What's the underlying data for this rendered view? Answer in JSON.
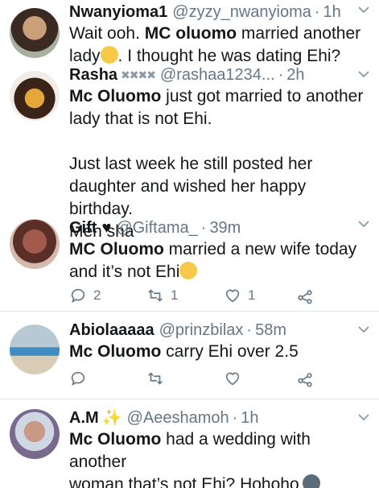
{
  "tweets": [
    {
      "name": "Nwanyioma1",
      "handle": "@zyzy_nwanyioma",
      "time": "1h",
      "line1_prefix": "Wait ooh. ",
      "line1_bold": "MC oluomo",
      "line1_suffix": " married another",
      "line2_prefix": "lady",
      "line2_suffix": ". I thought he was dating Ehi?",
      "emoji": "hand-over-mouth-emoji"
    },
    {
      "name": "Rasha",
      "name_decor": "✖✖✖✖",
      "handle": "@rashaa1234...",
      "time": "2h",
      "line1_bold": "Mc Oluomo",
      "line1_suffix": " just got married to another",
      "line2": "lady that is not Ehi.",
      "line3": "Just last week he still posted her",
      "line4": "daughter and wished her happy birthday.",
      "line5": "Men sha"
    },
    {
      "name": "Gift",
      "name_decor": "♥",
      "handle": "@Giftama_",
      "time": "39m",
      "line1_bold": "MC Oluomo",
      "line1_suffix": " married a new wife today",
      "line2": "and it’s not Ehi",
      "emoji": "face-with-monocle-emoji",
      "reply_count": "2",
      "retweet_count": "1",
      "like_count": "1"
    },
    {
      "name": "Abiolaaaaa",
      "handle": "@prinzbilax",
      "time": "58m",
      "line1_bold": "Mc Oluomo",
      "line1_suffix": " carry Ehi over 2.5"
    },
    {
      "name": "A.M",
      "name_decor": "✨",
      "handle": "@Aeeshamoh",
      "time": "1h",
      "line1_bold": "Mc Oluomo",
      "line1_suffix": " had a wedding with another",
      "line2": "woman that’s not Ehi? Hohoho",
      "emoji": "dark-face-emoji"
    }
  ],
  "dot": "·",
  "colors": {
    "text": "#14171a",
    "secondary": "#657786",
    "divider": "#e1e8ed"
  }
}
